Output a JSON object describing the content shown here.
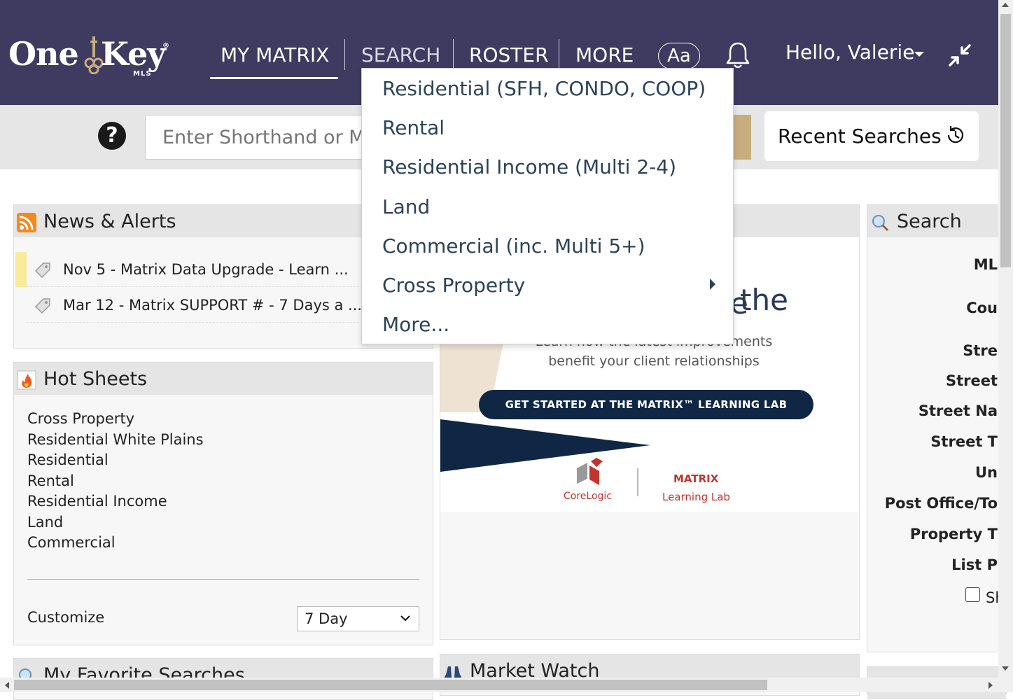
{
  "header": {
    "logo": {
      "one": "One",
      "key": "Key",
      "reg": "®",
      "mls": "MLS"
    },
    "nav": [
      {
        "label": "MY MATRIX"
      },
      {
        "label": "SEARCH"
      },
      {
        "label": "ROSTER"
      },
      {
        "label": "MORE"
      }
    ],
    "font_button": "Aa",
    "greeting": "Hello, Valerie"
  },
  "search_bar": {
    "placeholder": "Enter Shorthand or Mls #",
    "recent_searches": "Recent Searches"
  },
  "search_menu": {
    "items": [
      {
        "label": "Residential (SFH, CONDO, COOP)"
      },
      {
        "label": "Rental"
      },
      {
        "label": "Residential Income (Multi 2-4)"
      },
      {
        "label": "Land"
      },
      {
        "label": "Commercial (inc. Multi 5+)"
      },
      {
        "label": "Cross Property"
      },
      {
        "label": "More..."
      }
    ]
  },
  "news": {
    "title": "News & Alerts",
    "items": [
      {
        "text": "Nov 5 - Matrix Data Upgrade - Learn ..."
      },
      {
        "text": "Mar 12 - Matrix SUPPORT # - 7 Days a ..."
      }
    ]
  },
  "hot_sheets": {
    "title": "Hot Sheets",
    "items": [
      "Cross Property",
      "Residential White Plains",
      "Residential",
      "Rental",
      "Residential Income",
      "Land",
      "Commercial"
    ],
    "customize": "Customize",
    "period": "7 Day"
  },
  "favorites": {
    "title": "My Favorite Searches"
  },
  "promo": {
    "headline_1": "the",
    "headline_2": "e",
    "subtext_1": "Learn now the latest improvements",
    "subtext_2": "benefit your client relationships",
    "button": "GET STARTED AT THE MATRIX™ LEARNING LAB",
    "corelogic": "CoreLogic",
    "matrix": "MATRIX",
    "learning_lab": "Learning Lab"
  },
  "market_watch": {
    "title": "Market Watch"
  },
  "right_search": {
    "title": "Search",
    "labels": [
      "ML",
      "Cou",
      "Stre",
      "Street",
      "Street Na",
      "Street T",
      "Un",
      "Post Office/To",
      "Property T",
      "List P"
    ],
    "checkbox_label": "Sh"
  },
  "colors": {
    "header_bg": "#3f3a5f",
    "menu_text": "#2d4356",
    "gold": "#c8ad7f",
    "promo_navy": "#0f2744"
  }
}
